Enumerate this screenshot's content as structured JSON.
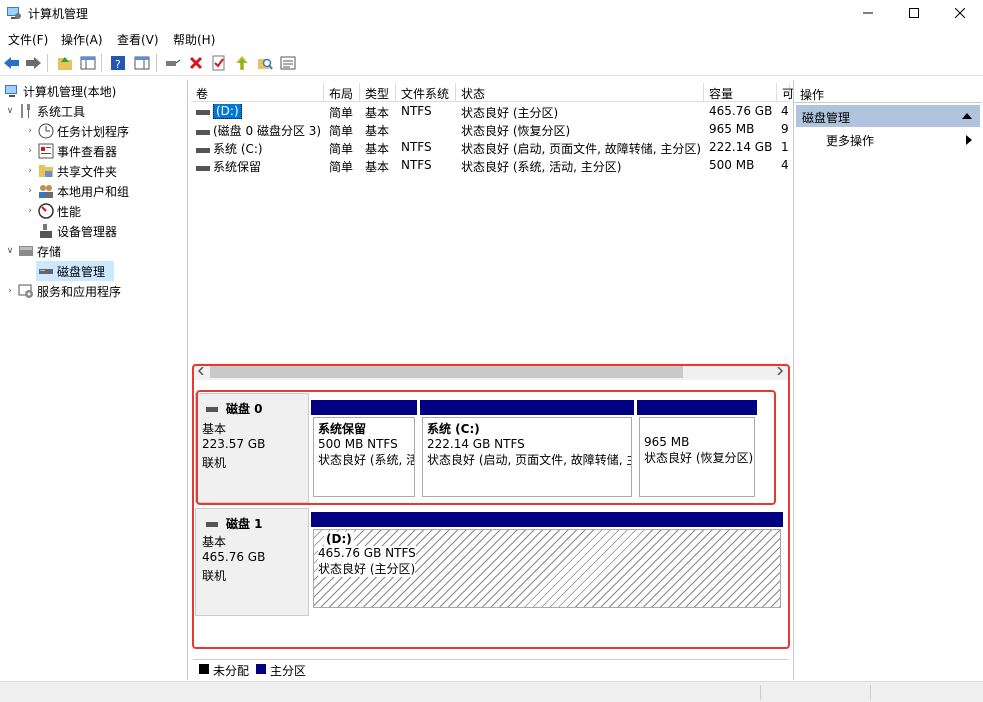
{
  "window": {
    "title": "计算机管理"
  },
  "menu": [
    "文件(F)",
    "操作(A)",
    "查看(V)",
    "帮助(H)"
  ],
  "tree": {
    "root": "计算机管理(本地)",
    "system_tools": "系统工具",
    "task_scheduler": "任务计划程序",
    "event_viewer": "事件查看器",
    "shared_folders": "共享文件夹",
    "local_users": "本地用户和组",
    "performance": "性能",
    "device_manager": "设备管理器",
    "storage": "存储",
    "disk_management": "磁盘管理",
    "services": "服务和应用程序"
  },
  "table": {
    "headers": [
      "卷",
      "布局",
      "类型",
      "文件系统",
      "状态",
      "容量",
      "可"
    ],
    "rows": [
      {
        "vol": "(D:)",
        "layout": "简单",
        "type": "基本",
        "fs": "NTFS",
        "status": "状态良好 (主分区)",
        "cap": "465.76 GB",
        "free": "4"
      },
      {
        "vol": "(磁盘 0 磁盘分区 3)",
        "layout": "简单",
        "type": "基本",
        "fs": "",
        "status": "状态良好 (恢复分区)",
        "cap": "965 MB",
        "free": "9"
      },
      {
        "vol": "系统 (C:)",
        "layout": "简单",
        "type": "基本",
        "fs": "NTFS",
        "status": "状态良好 (启动, 页面文件, 故障转储, 主分区)",
        "cap": "222.14 GB",
        "free": "1"
      },
      {
        "vol": "系统保留",
        "layout": "简单",
        "type": "基本",
        "fs": "NTFS",
        "status": "状态良好 (系统, 活动, 主分区)",
        "cap": "500 MB",
        "free": "4"
      }
    ]
  },
  "disk0": {
    "name": "磁盘 0",
    "kind": "基本",
    "size": "223.57 GB",
    "state": "联机",
    "parts": [
      {
        "name": "系统保留",
        "size": "500 MB NTFS",
        "status": "状态良好 (系统, 活"
      },
      {
        "name": "系统  (C:)",
        "size": "222.14 GB NTFS",
        "status": "状态良好 (启动, 页面文件, 故障转储, 主"
      },
      {
        "name": "",
        "size": "965 MB",
        "status": "状态良好 (恢复分区)"
      }
    ]
  },
  "disk1": {
    "name": "磁盘 1",
    "kind": "基本",
    "size": "465.76 GB",
    "state": "联机",
    "parts": [
      {
        "name": "(D:)",
        "size": "465.76 GB NTFS",
        "status": "状态良好 (主分区)"
      }
    ]
  },
  "legend": {
    "unallocated": "未分配",
    "primary": "主分区"
  },
  "actions": {
    "header": "操作",
    "section": "磁盘管理",
    "more": "更多操作"
  },
  "colors": {
    "primary_partition": "#000080",
    "highlight": "#e53935",
    "selected": "#cce8ff"
  }
}
